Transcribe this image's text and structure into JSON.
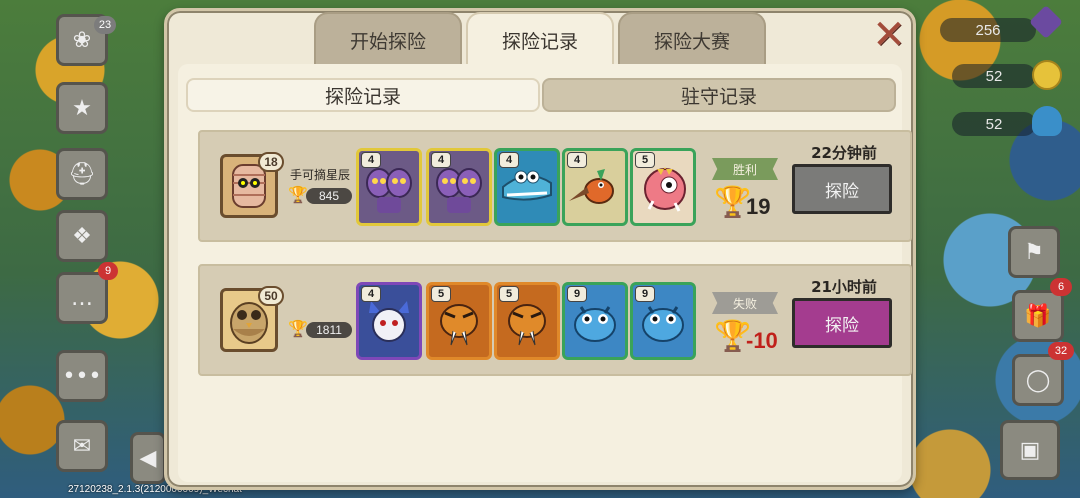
{
  "hud": {
    "left_badge": "23",
    "mail_badge": "9",
    "gems": "256",
    "coins": "52",
    "mushrooms": "52",
    "right_badge_1": "6",
    "right_badge_2": "32",
    "map_label": "",
    "version": "27120238_2.1.3(2120000009)_Wechat"
  },
  "tabs": {
    "start": "开始探险",
    "record": "探险记录",
    "contest": "探险大赛"
  },
  "subtabs": {
    "explore_record": "探险记录",
    "garrison_record": "驻守记录"
  },
  "records": [
    {
      "player_name": "手可摘星辰",
      "level": "18",
      "score": "845",
      "avatar_icon": "mummy-avatar-icon",
      "result": "胜利",
      "result_color": "#7a9b5c",
      "trophy_delta": "19",
      "delta_color": "#2a2622",
      "time": "22分钟前",
      "button_label": "探险",
      "button_color": "#7b7b79",
      "monsters": [
        {
          "level": "4",
          "icon": "purple-twin-dragon-icon",
          "border": "#e2c83a",
          "bg": "#6c5a86"
        },
        {
          "level": "4",
          "icon": "purple-twin-dragon-icon",
          "border": "#e2c83a",
          "bg": "#6c5a86"
        },
        {
          "level": "4",
          "icon": "blue-crocodile-icon",
          "border": "#3aa35a",
          "bg": "#2f8bb7"
        },
        {
          "level": "4",
          "icon": "orange-bird-icon",
          "border": "#3aa35a",
          "bg": "#d9cf9c"
        },
        {
          "level": "5",
          "icon": "pink-cyclops-icon",
          "border": "#3aa35a",
          "bg": "#e07c8a"
        }
      ]
    },
    {
      "player_name": "",
      "level": "50",
      "score": "1811",
      "avatar_icon": "owl-avatar-icon",
      "result": "失败",
      "result_color": "#9e9c96",
      "trophy_delta": "-10",
      "delta_color": "#c0201a",
      "time": "21小时前",
      "button_label": "探险",
      "button_color": "#a43c8f",
      "monsters": [
        {
          "level": "4",
          "icon": "white-dragon-icon",
          "border": "#7e48b8",
          "bg": "#3a4f9a"
        },
        {
          "level": "5",
          "icon": "sabertooth-tiger-icon",
          "border": "#e0892a",
          "bg": "#c56a1f"
        },
        {
          "level": "5",
          "icon": "sabertooth-tiger-icon",
          "border": "#e0892a",
          "bg": "#c56a1f"
        },
        {
          "level": "9",
          "icon": "blue-dino-icon",
          "border": "#3aa35a",
          "bg": "#3d87c4"
        },
        {
          "level": "9",
          "icon": "blue-dino-icon",
          "border": "#3aa35a",
          "bg": "#3d87c4"
        }
      ]
    }
  ]
}
